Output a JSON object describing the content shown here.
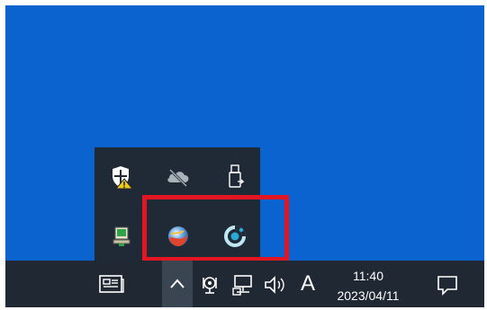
{
  "tray_overflow": {
    "row1": [
      {
        "icon": "windows-security-warning-icon"
      },
      {
        "icon": "onedrive-offline-icon"
      },
      {
        "icon": "usb-safely-remove-icon"
      }
    ],
    "row2": [
      {
        "icon": "network-adapter-icon"
      },
      {
        "icon": "colorful-ball-app-icon"
      },
      {
        "icon": "circular-app-icon"
      }
    ]
  },
  "taskbar": {
    "ime_label": "A",
    "clock": {
      "time": "11:40",
      "date": "2023/04/11"
    }
  },
  "colors": {
    "desktop": "#0a63cf",
    "taskbar": "#202834",
    "popup": "#1f2a36",
    "highlight": "#e21523"
  }
}
